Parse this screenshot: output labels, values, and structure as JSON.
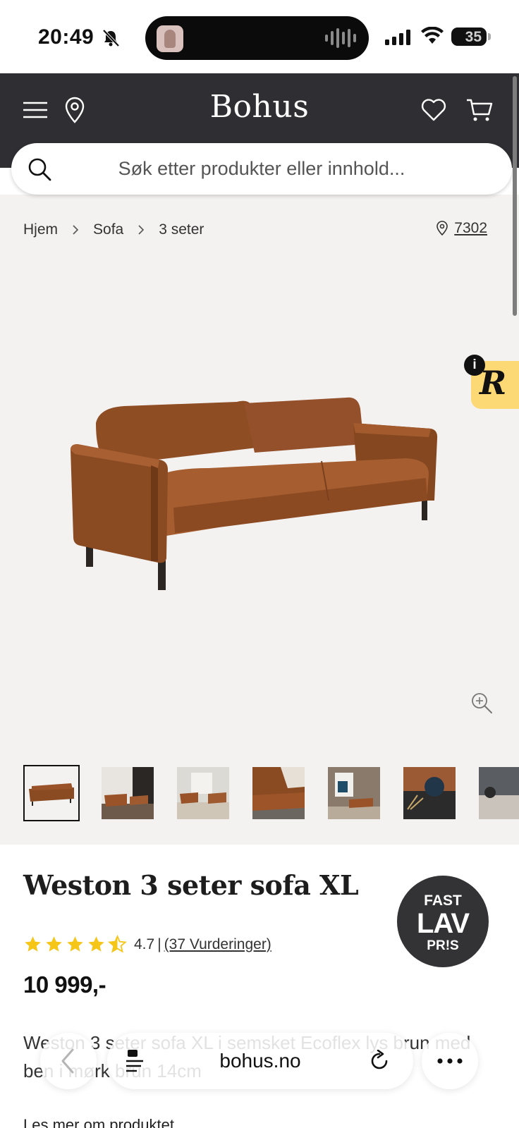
{
  "status_bar": {
    "time": "20:49",
    "battery": "35"
  },
  "header": {
    "logo": "Bohus",
    "icons": [
      "menu-icon",
      "location-pin-icon",
      "heart-icon",
      "cart-icon"
    ]
  },
  "search": {
    "placeholder": "Søk etter produkter eller innhold..."
  },
  "breadcrumb": {
    "items": [
      "Hjem",
      "Sofa",
      "3 seter"
    ],
    "store_number": "7302"
  },
  "product": {
    "title": "Weston 3 seter sofa XL",
    "rating_value": "4.7",
    "rating_separator": "|",
    "rating_count": "(37 Vurderinger)",
    "rating_fraction": 0.94,
    "price": "10 999,-",
    "description": "Weston 3 seter sofa XL i semsket Ecoflex lys brun med ben i mørk brun 14cm",
    "read_more": "Les mer om produktet",
    "badge": {
      "line1": "FAST",
      "line2": "LAV",
      "line3": "PR!S"
    }
  },
  "gallery": {
    "thumbnail_count": 7,
    "selected_index": 0
  },
  "browser": {
    "domain": "bohus.no"
  },
  "colors": {
    "header_bg": "#2f2f33",
    "gallery_bg": "#f4f2f1",
    "star": "#f5c518",
    "badge_bg": "#333335",
    "leather": "#9a5326"
  }
}
